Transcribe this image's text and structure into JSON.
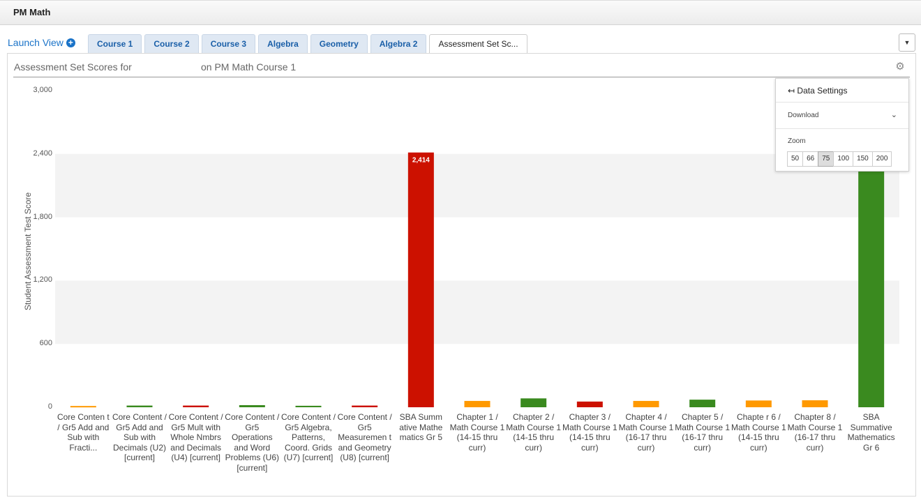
{
  "app": {
    "title": "PM Math"
  },
  "launch_view": {
    "label": "Launch View"
  },
  "tabs": [
    {
      "label": "Course 1"
    },
    {
      "label": "Course 2"
    },
    {
      "label": "Course 3"
    },
    {
      "label": "Algebra"
    },
    {
      "label": "Geometry"
    },
    {
      "label": "Algebra 2"
    },
    {
      "label": "Assessment Set Sc...",
      "active": true
    }
  ],
  "panel": {
    "title_prefix": "Assessment Set Scores for",
    "title_suffix": "on PM Math Course 1"
  },
  "icons": {
    "menu": "caret-down-icon",
    "settings": "gear-icon",
    "add": "plus-circle-icon"
  },
  "colors": {
    "orange": "#ff9900",
    "green": "#3a8a1f",
    "red": "#cc1100",
    "link": "#1a73c8"
  },
  "chart_data": {
    "type": "bar",
    "title": "",
    "ylabel": "Student Assessment Test Score",
    "xlabel": "",
    "ylim": [
      0,
      3000
    ],
    "yticks": [
      "0",
      "600",
      "1,200",
      "1,800",
      "2,400",
      "3,000"
    ],
    "grid": "alternating horizontal bands",
    "categories": [
      "Core Conten t / Gr5 Add and Sub with Fracti...",
      "Core Content / Gr5 Add and Sub with Decimals (U2) [current]",
      "Core Content / Gr5 Mult with Whole Nmbrs and Decimals (U4) [current]",
      "Core Content / Gr5 Operations and Word Problems (U6) [current]",
      "Core Content / Gr5 Algebra, Patterns, Coord. Grids (U7) [current]",
      "Core Content / Gr5 Measuremen t and Geometry (U8) [current]",
      "SBA Summ ative Mathe matics Gr 5",
      "Chapter 1 / Math Course 1 (14-15 thru curr)",
      "Chapter 2 / Math Course 1 (14-15 thru curr)",
      "Chapter 3 / Math Course 1 (14-15 thru curr)",
      "Chapter 4 / Math Course 1 (16-17 thru curr)",
      "Chapter 5 / Math Course 1 (16-17 thru curr)",
      "Chapte r 6 / Math Course 1 (14-15 thru curr)",
      "Chapter 8 / Math Course 1 (16-17 thru curr)",
      "SBA Summative Mathematics Gr 6"
    ],
    "values": [
      12,
      16,
      16,
      20,
      14,
      16,
      2414,
      60,
      84,
      54,
      60,
      72,
      64,
      66,
      2390
    ],
    "colors": [
      "#ff9900",
      "#3a8a1f",
      "#cc1100",
      "#3a8a1f",
      "#3a8a1f",
      "#cc1100",
      "#cc1100",
      "#ff9900",
      "#3a8a1f",
      "#cc1100",
      "#ff9900",
      "#3a8a1f",
      "#ff9900",
      "#ff9900",
      "#3a8a1f"
    ],
    "data_labels": {
      "6": "2,414"
    }
  },
  "settings_popup": {
    "data_settings": "Data Settings",
    "download": "Download",
    "zoom_label": "Zoom",
    "zoom_options": [
      "50",
      "66",
      "75",
      "100",
      "150",
      "200"
    ],
    "zoom_selected": "75"
  }
}
